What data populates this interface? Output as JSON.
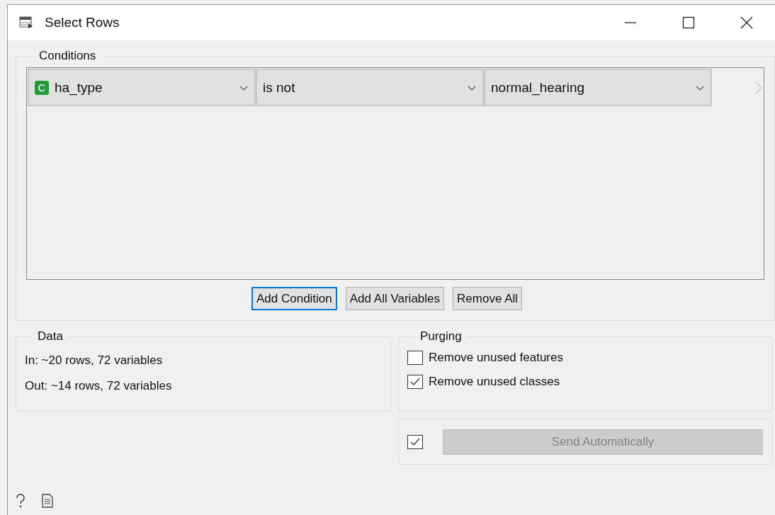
{
  "window": {
    "title": "Select Rows"
  },
  "conditions": {
    "title": "Conditions",
    "rows": [
      {
        "variable": {
          "badge": "C",
          "value": "ha_type"
        },
        "operator": "is not",
        "value": "normal_hearing"
      }
    ],
    "buttons": [
      {
        "label": "Add Condition",
        "focused": true
      },
      {
        "label": "Add All Variables",
        "focused": false
      },
      {
        "label": "Remove All",
        "focused": false
      }
    ]
  },
  "data": {
    "title": "Data",
    "lines": [
      "In: ~20 rows, 72 variables",
      "Out: ~14 rows, 72 variables"
    ]
  },
  "purging": {
    "title": "Purging",
    "options": [
      {
        "label": "Remove unused features",
        "checked": false
      },
      {
        "label": "Remove unused classes",
        "checked": true
      }
    ]
  },
  "send": {
    "checked": true,
    "label": "Send Automatically",
    "disabled": true
  }
}
